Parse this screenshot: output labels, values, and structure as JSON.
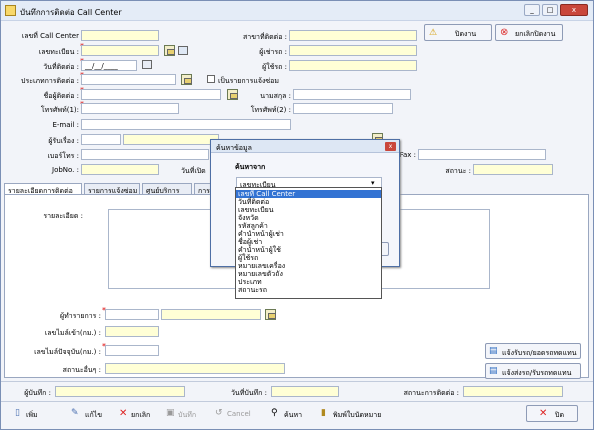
{
  "window": {
    "title": "บันทึกการติดต่อ Call Center",
    "controls": [
      "_",
      "□",
      "x"
    ]
  },
  "top_buttons": {
    "cancel": "ปิดงาน",
    "reopen": "ยกเลิกปิดงาน"
  },
  "form": {
    "call_no": "เลขที่ Call Center",
    "branch": "สาขาที่ติดต่อ :",
    "reg_no": "เลขทะเบียน :",
    "renter": "ผู้เช่ารถ :",
    "contact_date": "วันที่ติดต่อ :",
    "contact_date_value": "__/__/____",
    "user": "ผู้ใช้รถ :",
    "contact_type": "ประเภทการติดต่อ :",
    "is_report": "เป็นรายการแจ้งซ่อม",
    "contact_name": "ชื่อผู้ติดต่อ :",
    "surname": "นามสกุล :",
    "phone1": "โทรศัพท์(1):",
    "phone2": "โทรศัพท์(2) :",
    "email": "E-mail :",
    "receiver": "ผู้รับเรื่อง :",
    "phone_no": "เบอร์โทร :",
    "fax": "Fax :",
    "jobno": "JobNo. :",
    "open_date": "วันที่เปิด",
    "status": "สถานะ :"
  },
  "tabs": [
    "รายละเอียดการติดต่อ",
    "รายการแจ้งซ่อม",
    "ศูนย์บริการ",
    "การติ"
  ],
  "detail": {
    "description": "รายละเอียด :",
    "worker": "ผู้ทำรายการ :",
    "odo_out": "เลขไมล์เข้า(กม.) :",
    "odo_in": "เลขไมล์ปัจจุบัน(กม.) :",
    "parts": "สถานะอื่นๆ :",
    "btn_send": "แจ้งรับรถ/ยอดรถทดแทน",
    "btn_return": "แจ้งส่งรถ/รับรถทดแทน"
  },
  "footer_info": {
    "recorder": "ผู้บันทึก :",
    "record_date": "วันที่บันทึก :",
    "contact_status": "สถานะการติดต่อ :"
  },
  "toolbar": {
    "add": "เพิ่ม",
    "edit": "แก้ไข",
    "delete": "ยกเลิก",
    "save": "บันทึก",
    "cancel": "Cancel",
    "search": "ค้นหา",
    "print": "พิมพ์ใบนัดหมาย",
    "close": "ปิด"
  },
  "dialog": {
    "title": "ค้นหาข้อมูล",
    "label": "ค้นหาจาก",
    "selected": "เลขทะเบียน",
    "options": [
      "เลขที่ Call Center",
      "วันที่ติดต่อ",
      "เลขทะเบียน",
      "จังหวัด",
      "รหัสลูกค้า",
      "คำนำหน้าผู้เช่า",
      "ชื่อผู้เช่า",
      "คำนำหน้าผู้ใช้",
      "ผู้ใช้รถ",
      "หมายเลขเครื่อง",
      "หมายเลขตัวถัง",
      "ประเภท",
      "สถานะรถ"
    ]
  },
  "colors": {
    "accent": "#3373d3",
    "required": "#dd0000",
    "field_yellow": "#ffffd6"
  }
}
